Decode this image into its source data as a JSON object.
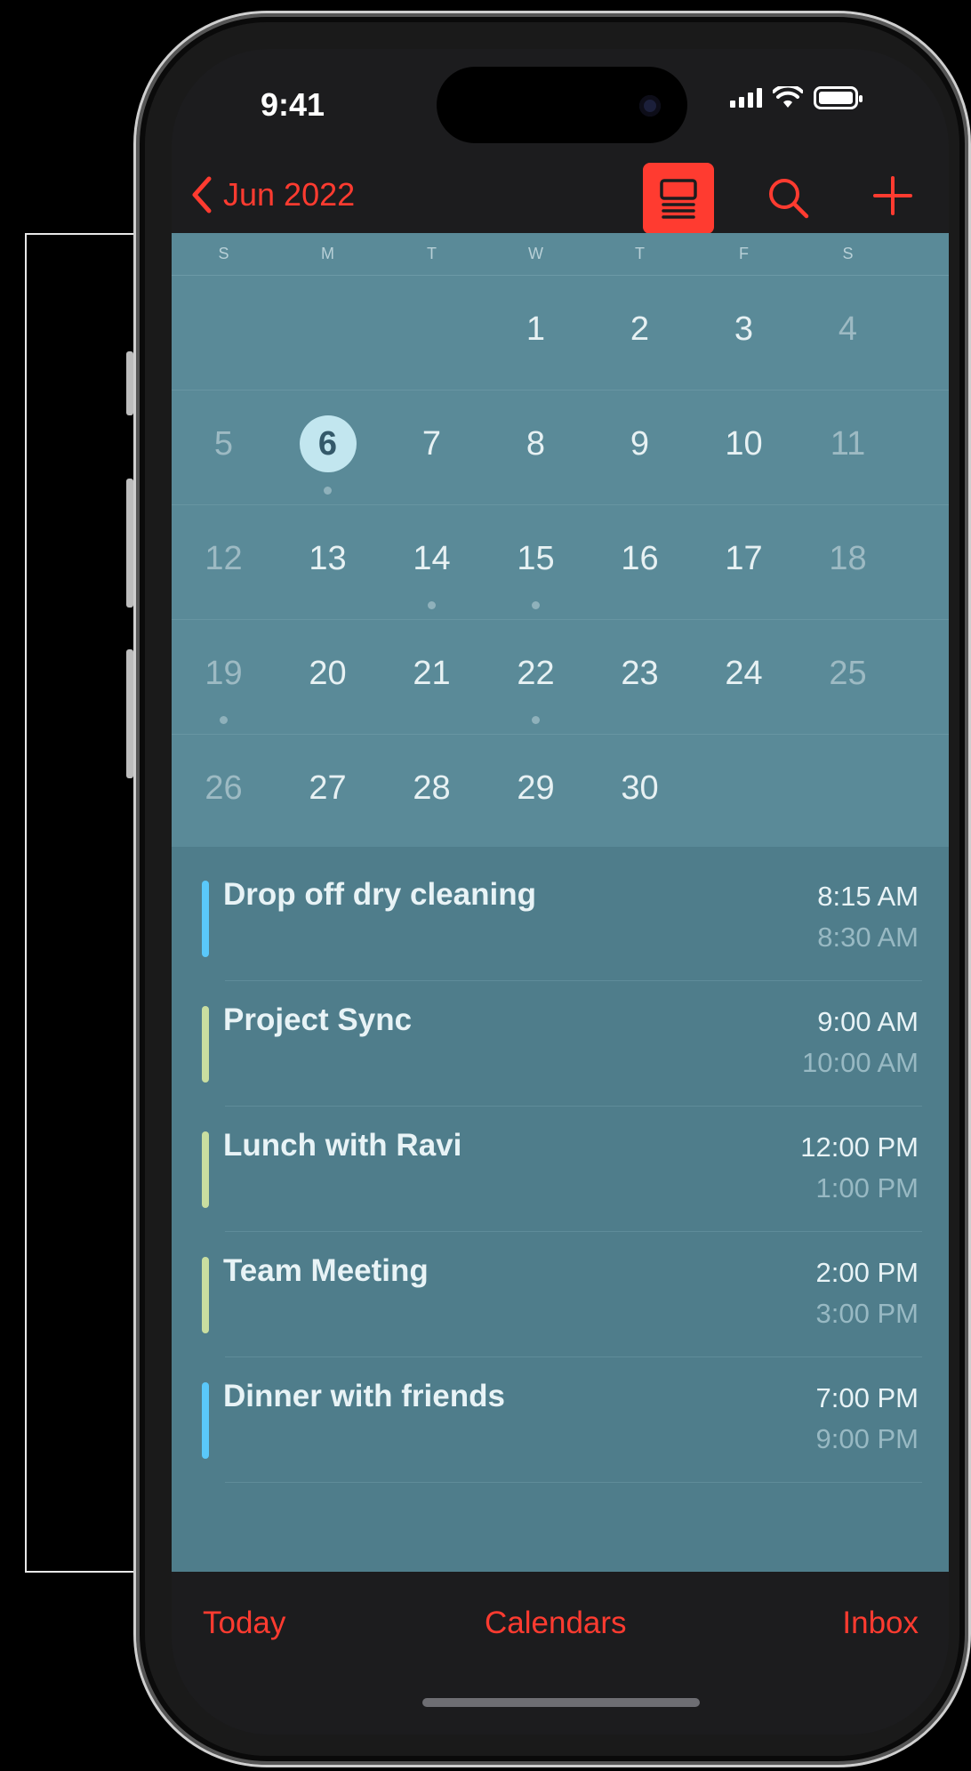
{
  "status_bar": {
    "time": "9:41"
  },
  "nav": {
    "back_label": "Jun 2022",
    "accent_color": "#ff3b30"
  },
  "weekdays": [
    "S",
    "M",
    "T",
    "W",
    "T",
    "F",
    "S"
  ],
  "month": {
    "today": "6",
    "weeks": [
      [
        "",
        "",
        "",
        "1",
        "2",
        "3",
        "4"
      ],
      [
        "5",
        "6",
        "7",
        "8",
        "9",
        "10",
        "11"
      ],
      [
        "12",
        "13",
        "14",
        "15",
        "16",
        "17",
        "18"
      ],
      [
        "19",
        "20",
        "21",
        "22",
        "23",
        "24",
        "25"
      ],
      [
        "26",
        "27",
        "28",
        "29",
        "30",
        "",
        ""
      ]
    ],
    "days_with_events": [
      "6",
      "14",
      "15",
      "19",
      "22"
    ]
  },
  "events": [
    {
      "title": "Drop off dry cleaning",
      "start": "8:15 AM",
      "end": "8:30 AM",
      "color": "#5ac8fa"
    },
    {
      "title": "Project Sync",
      "start": "9:00 AM",
      "end": "10:00 AM",
      "color": "#c9dea0"
    },
    {
      "title": "Lunch with Ravi",
      "start": "12:00 PM",
      "end": "1:00 PM",
      "color": "#c9dea0"
    },
    {
      "title": "Team Meeting",
      "start": "2:00 PM",
      "end": "3:00 PM",
      "color": "#c9dea0"
    },
    {
      "title": "Dinner with friends",
      "start": "7:00 PM",
      "end": "9:00 PM",
      "color": "#5ac8fa"
    }
  ],
  "tab_bar": {
    "today_label": "Today",
    "calendars_label": "Calendars",
    "inbox_label": "Inbox"
  },
  "icons": {
    "back": "chevron-left-icon",
    "list_toggle": "list-view-icon",
    "search": "search-icon",
    "add": "plus-icon"
  }
}
